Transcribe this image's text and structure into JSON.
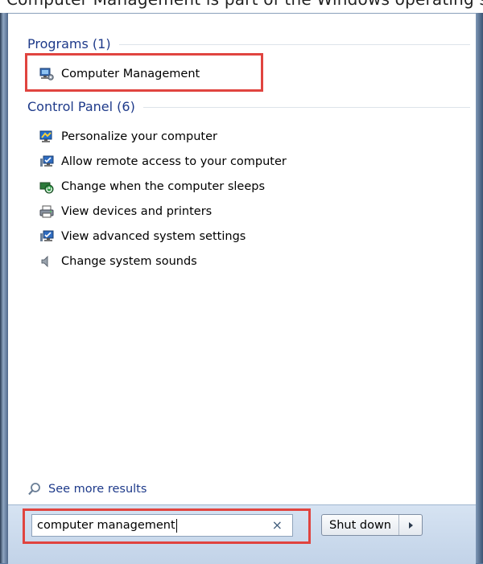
{
  "top_strip": {
    "text": "Computer Management is part of the Windows operating system"
  },
  "programs": {
    "header": "Programs (1)",
    "items": [
      {
        "label": "Computer Management",
        "icon": "computer-management-icon"
      }
    ]
  },
  "control_panel": {
    "header": "Control Panel (6)",
    "items": [
      {
        "label": "Personalize your computer",
        "icon": "personalize-icon"
      },
      {
        "label": "Allow remote access to your computer",
        "icon": "system-icon"
      },
      {
        "label": "Change when the computer sleeps",
        "icon": "power-options-icon"
      },
      {
        "label": "View devices and printers",
        "icon": "printer-icon"
      },
      {
        "label": "View advanced system settings",
        "icon": "system-icon"
      },
      {
        "label": "Change system sounds",
        "icon": "speaker-icon"
      }
    ]
  },
  "see_more": {
    "label": "See more results",
    "icon": "search-icon"
  },
  "search": {
    "value": "computer management",
    "clear_glyph": "×"
  },
  "shutdown": {
    "label": "Shut down",
    "arrow_glyph": "▸"
  },
  "colors": {
    "section_header": "#1e3a8a",
    "highlight": "#e0443f"
  }
}
